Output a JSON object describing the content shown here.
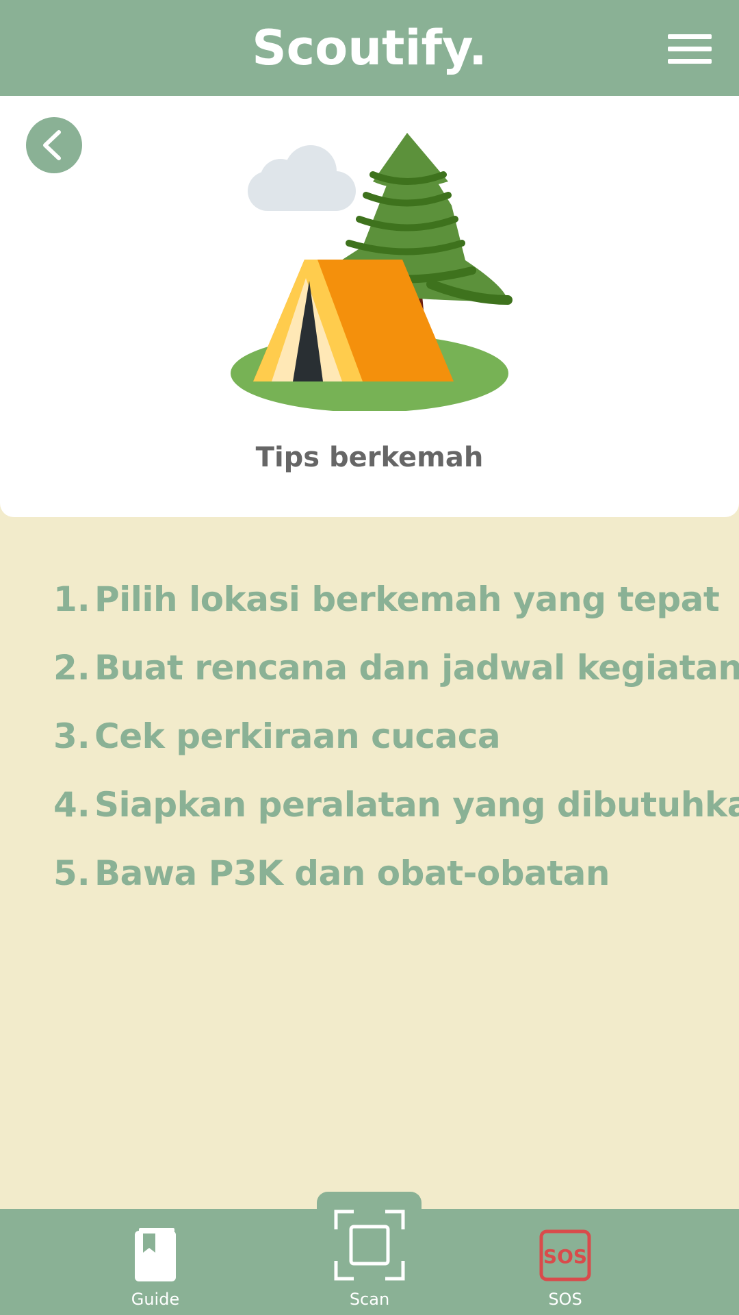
{
  "app": {
    "title": "Scoutify."
  },
  "card": {
    "title": "Tips berkemah"
  },
  "tips": [
    {
      "num": "1.",
      "text": "Pilih lokasi berkemah yang tepat"
    },
    {
      "num": "2.",
      "text": "Buat rencana dan jadwal kegiatan"
    },
    {
      "num": "3.",
      "text": "Cek perkiraan cucaca"
    },
    {
      "num": "4.",
      "text": "Siapkan peralatan yang dibutuhkan"
    },
    {
      "num": "5.",
      "text": "Bawa P3K dan obat-obatan"
    }
  ],
  "nav": {
    "guide": {
      "label": "Guide",
      "icon": "book-icon"
    },
    "scan": {
      "label": "Scan",
      "icon": "scan-frame-icon"
    },
    "sos": {
      "label": "SOS",
      "icon": "sos-icon",
      "icon_text": "SOS"
    }
  },
  "icons": {
    "menu": "hamburger-menu-icon",
    "back": "chevron-left-icon"
  },
  "colors": {
    "primary": "#8AB195",
    "background": "#F2EBCB",
    "sos": "#D94B4B",
    "title_gray": "#666666"
  }
}
